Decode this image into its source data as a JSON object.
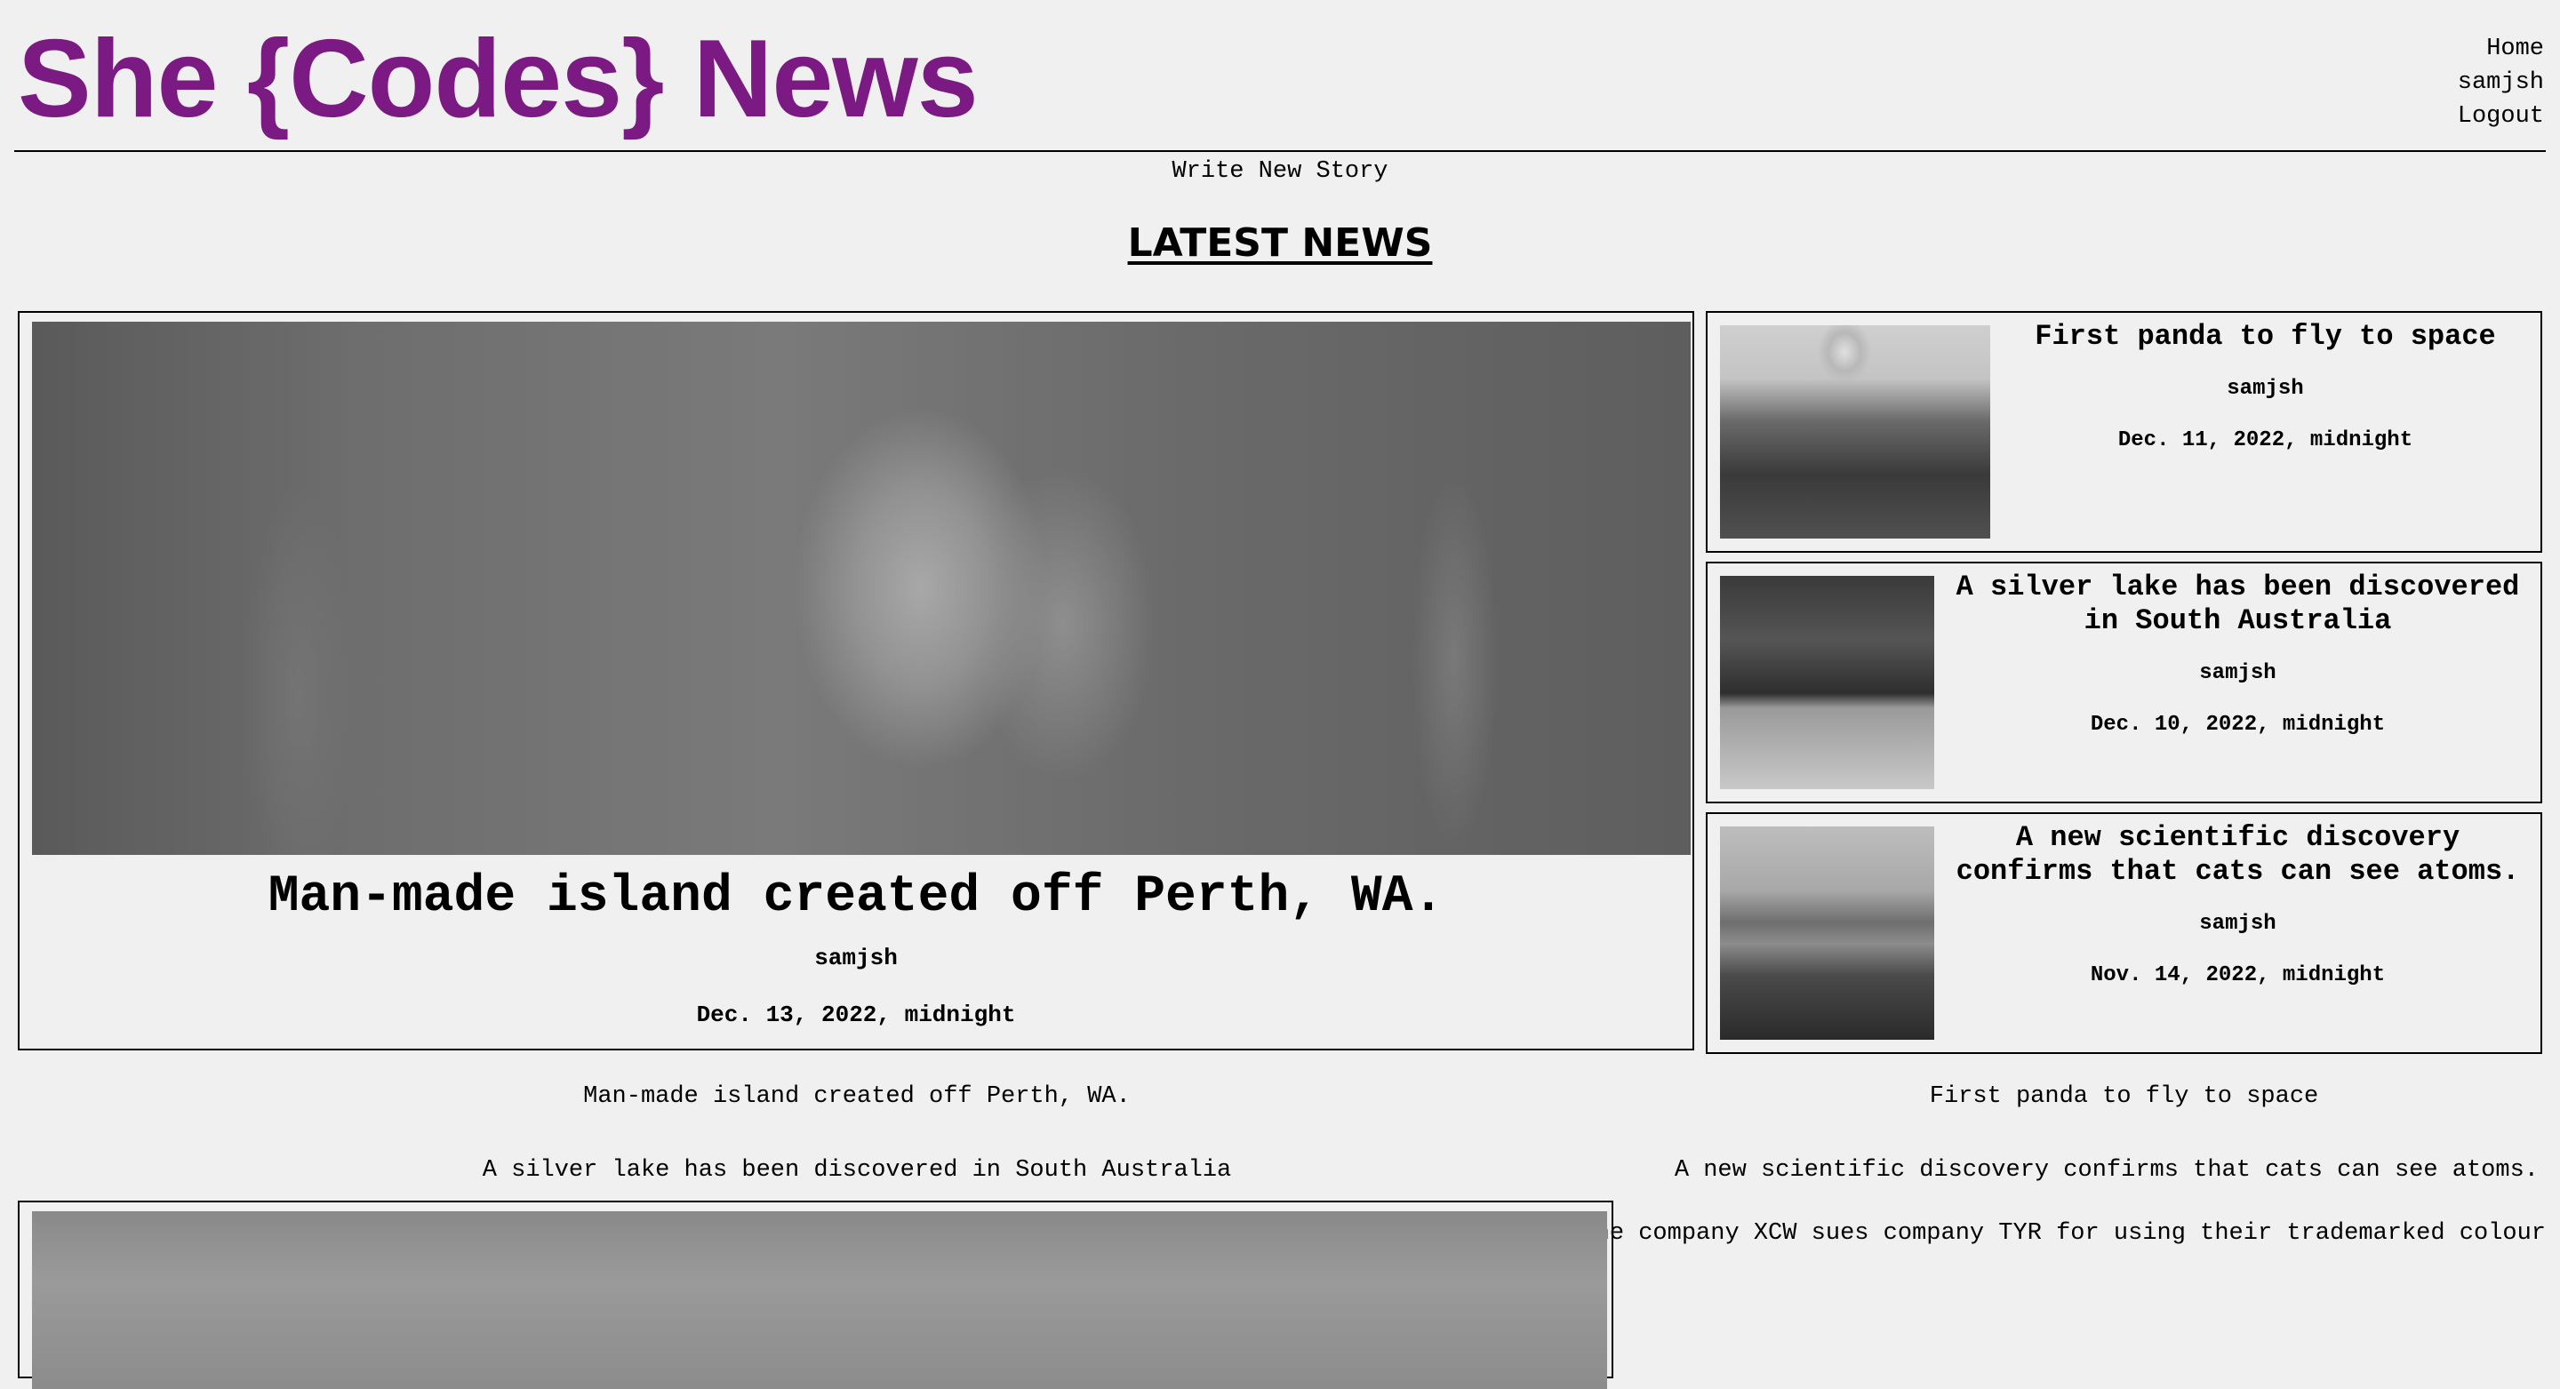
{
  "header": {
    "site_title": "She {Codes} News",
    "nav": [
      "Home",
      "samjsh",
      "Logout"
    ],
    "write_link": "Write New Story"
  },
  "section_heading": "LATEST NEWS",
  "featured": {
    "title": "Man-made island created off Perth, WA.",
    "author": "samjsh",
    "date": "Dec. 13, 2022, midnight",
    "image": "tulip-photo"
  },
  "side_stories": [
    {
      "title": "First panda to fly to space",
      "author": "samjsh",
      "date": "Dec. 11, 2022, midnight",
      "image": "hot-air-balloon-photo"
    },
    {
      "title": "A silver lake has been discovered in South Australia",
      "author": "samjsh",
      "date": "Dec. 10, 2022, midnight",
      "image": "train-platform-photo"
    },
    {
      "title": "A new scientific discovery confirms that cats can see atoms.",
      "author": "samjsh",
      "date": "Nov. 14, 2022, midnight",
      "image": "lake-grass-photo"
    }
  ],
  "story_links": [
    "Man-made island created off Perth, WA.",
    "First panda to fly to space",
    "A silver lake has been discovered in South Australia",
    "A new scientific discovery confirms that cats can see atoms.",
    "The company XCW sues company TYR for using their trademarked colour"
  ],
  "colors": {
    "brand": "#7a1a82",
    "background": "#f0f0f0"
  }
}
